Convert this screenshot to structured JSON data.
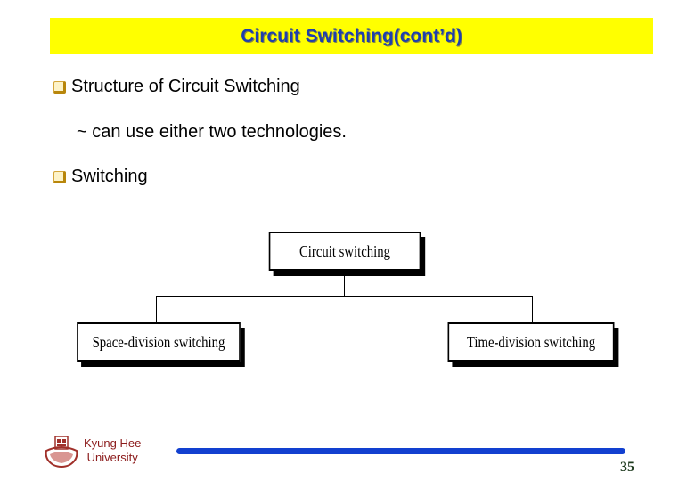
{
  "slide": {
    "title": "Circuit Switching(cont’d)",
    "bullets": [
      {
        "icon": "square-bullet-icon",
        "text": "Structure of Circuit Switching"
      },
      {
        "icon": "square-bullet-icon",
        "text": "Switching"
      }
    ],
    "sub_text": "~ can use either two technologies.",
    "colors": {
      "title_bg": "#ffff00",
      "title_text": "#1e3fae",
      "bullet": "#b8860b",
      "footer_bar": "#1240d0",
      "university_text": "#8b1a1a"
    }
  },
  "diagram": {
    "root": "Circuit switching",
    "children": [
      "Space-division switching",
      "Time-division switching"
    ]
  },
  "footer": {
    "university_line1": "Kyung Hee",
    "university_line2": "University",
    "logo_icon": "university-emblem-icon",
    "page_number": "35"
  }
}
